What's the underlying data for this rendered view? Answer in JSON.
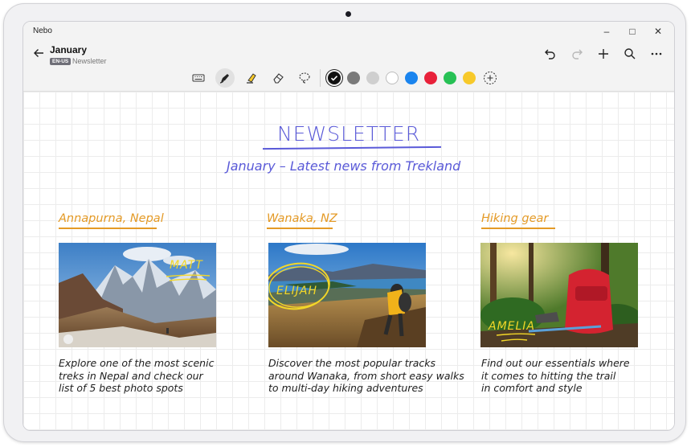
{
  "app": {
    "name": "Nebo"
  },
  "window_controls": {
    "minimize": "–",
    "maximize": "□",
    "close": "✕"
  },
  "document": {
    "title": "January",
    "language": "EN-US",
    "notebook": "Newsletter"
  },
  "toolbar": {
    "tools": [
      {
        "name": "keyboard-icon",
        "active": false
      },
      {
        "name": "pen-icon",
        "active": true
      },
      {
        "name": "highlighter-icon",
        "active": false
      },
      {
        "name": "eraser-icon",
        "active": false
      },
      {
        "name": "lasso-icon",
        "active": false
      }
    ],
    "colors": [
      {
        "name": "black",
        "hex": "#111111",
        "selected": true
      },
      {
        "name": "dark-gray",
        "hex": "#7a7a7a",
        "selected": false
      },
      {
        "name": "light-gray",
        "hex": "#cfcfcf",
        "selected": false
      },
      {
        "name": "white",
        "hex": "#ffffff",
        "selected": false
      },
      {
        "name": "blue",
        "hex": "#1a84ee",
        "selected": false
      },
      {
        "name": "red",
        "hex": "#e8213a",
        "selected": false
      },
      {
        "name": "green",
        "hex": "#27c155",
        "selected": false
      },
      {
        "name": "yellow",
        "hex": "#f7c92a",
        "selected": false
      }
    ],
    "add_color_icon": "add-color-icon"
  },
  "actions": [
    "undo-icon",
    "redo-icon",
    "add-icon",
    "search-icon",
    "more-icon"
  ],
  "canvas": {
    "title": "NEWSLETTER",
    "subtitle": "January – Latest news from Trekland",
    "cards": [
      {
        "heading": "Annapurna, Nepal",
        "tag": "MATT",
        "caption": [
          "Explore one of the most scenic",
          "treks in Nepal and check our",
          "list of 5 best photo spots"
        ]
      },
      {
        "heading": "Wanaka, NZ",
        "tag": "ELIJAH",
        "caption": [
          "Discover the most popular tracks",
          "around Wanaka, from short easy walks",
          "to multi-day hiking adventures"
        ]
      },
      {
        "heading": "Hiking gear",
        "tag": "AMELIA",
        "caption": [
          "Find out our essentials where",
          "it comes to hitting the trail",
          "in comfort and style"
        ]
      }
    ]
  },
  "colors": {
    "ink_blue": "#5a5ad8",
    "ink_orange": "#e49a26",
    "highlight_yellow": "#f3d728"
  }
}
